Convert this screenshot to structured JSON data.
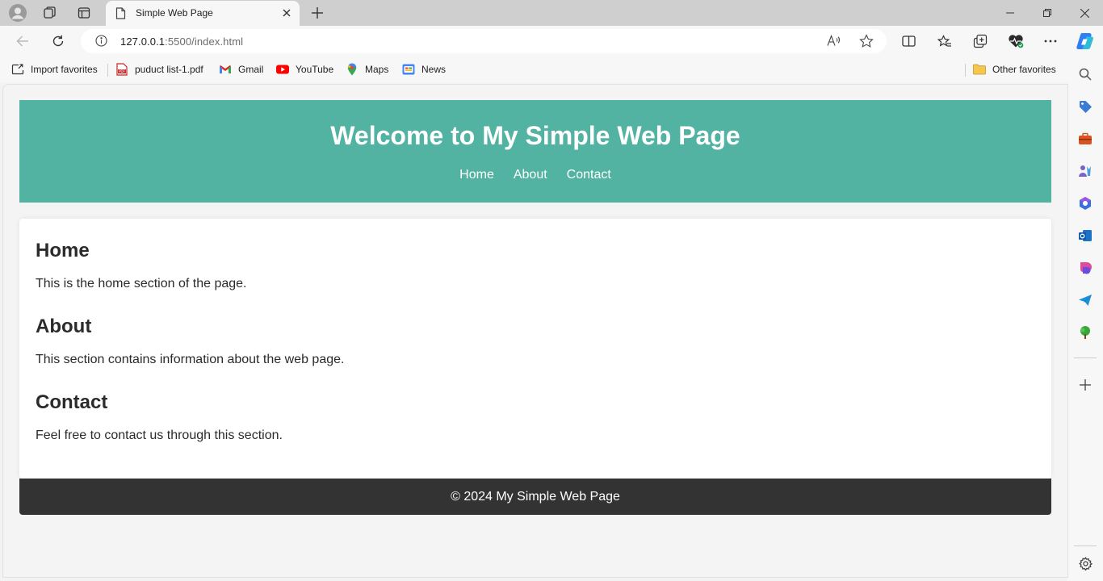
{
  "browser": {
    "tab": {
      "title": "Simple Web Page"
    },
    "address": {
      "host": "127.0.0.1",
      "rest": ":5500/index.html"
    },
    "favorites": [
      {
        "label": "Import favorites",
        "icon": "import-icon"
      },
      {
        "label": "puduct list-1.pdf",
        "icon": "pdf-icon"
      },
      {
        "label": "Gmail",
        "icon": "gmail-icon"
      },
      {
        "label": "YouTube",
        "icon": "youtube-icon"
      },
      {
        "label": "Maps",
        "icon": "maps-icon"
      },
      {
        "label": "News",
        "icon": "news-icon"
      }
    ],
    "other_favorites": "Other favorites",
    "colors": {
      "chrome": "#cfcfcf",
      "toolbar": "#f7f7f7"
    }
  },
  "page": {
    "header": {
      "title": "Welcome to My Simple Web Page",
      "nav": [
        "Home",
        "About",
        "Contact"
      ],
      "color": "#52b3a2"
    },
    "sections": [
      {
        "heading": "Home",
        "text": "This is the home section of the page."
      },
      {
        "heading": "About",
        "text": "This section contains information about the web page."
      },
      {
        "heading": "Contact",
        "text": "Feel free to contact us through this section."
      }
    ],
    "footer": {
      "text": "© 2024 My Simple Web Page",
      "color": "#333333"
    }
  }
}
